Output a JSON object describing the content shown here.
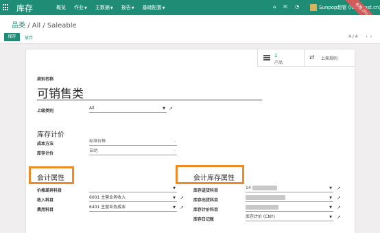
{
  "navbar": {
    "brand": "库存",
    "menu": [
      {
        "label": "概览",
        "caret": ""
      },
      {
        "label": "作业",
        "caret": "▼"
      },
      {
        "label": "主数据",
        "caret": "▼"
      },
      {
        "label": "报告",
        "caret": "▼"
      },
      {
        "label": "基础配置",
        "caret": "▼"
      }
    ],
    "user_name": "Sunpop超管 (localhost.cn)",
    "ribbon_text": "本地 (Pri.ip)"
  },
  "breadcrumb": {
    "root": "品类",
    "separator": " / ",
    "current": "All / Saleable"
  },
  "actions": {
    "save": "保存",
    "discard": "放弃"
  },
  "pager": {
    "value": "4 / 4",
    "prev": "‹",
    "next": "›"
  },
  "buttons": {
    "products_count": "1",
    "products_label": "产品",
    "rules_label": "上架规则"
  },
  "form": {
    "name_label": "类别名称",
    "name_value": "可销售类",
    "parent_label": "上级类别",
    "parent_value": "All",
    "inventory_valuation_title": "库存计价",
    "costing_method_label": "成本方法",
    "costing_method_value": "标准价格",
    "valuation_label": "库存计价",
    "valuation_value": "自动",
    "account_props_title": "会计属性",
    "price_diff_label": "价格差异科目",
    "price_diff_value": "",
    "income_label": "收入科目",
    "income_value": "6001 主营业务收入",
    "expense_label": "费用科目",
    "expense_value": "6401 主营业务成本",
    "stock_props_title": "会计库存属性",
    "stock_input_label": "库存进货科目",
    "stock_input_value": "14",
    "stock_output_label": "库存出货科目",
    "stock_output_value": "",
    "stock_valuation_label": "库存计价科目",
    "stock_valuation_value": "",
    "stock_journal_label": "库存日记账",
    "stock_journal_value": "库存计价 (CNY)"
  },
  "colors": {
    "brand": "#1f8c76",
    "highlight": "#f08a24"
  }
}
